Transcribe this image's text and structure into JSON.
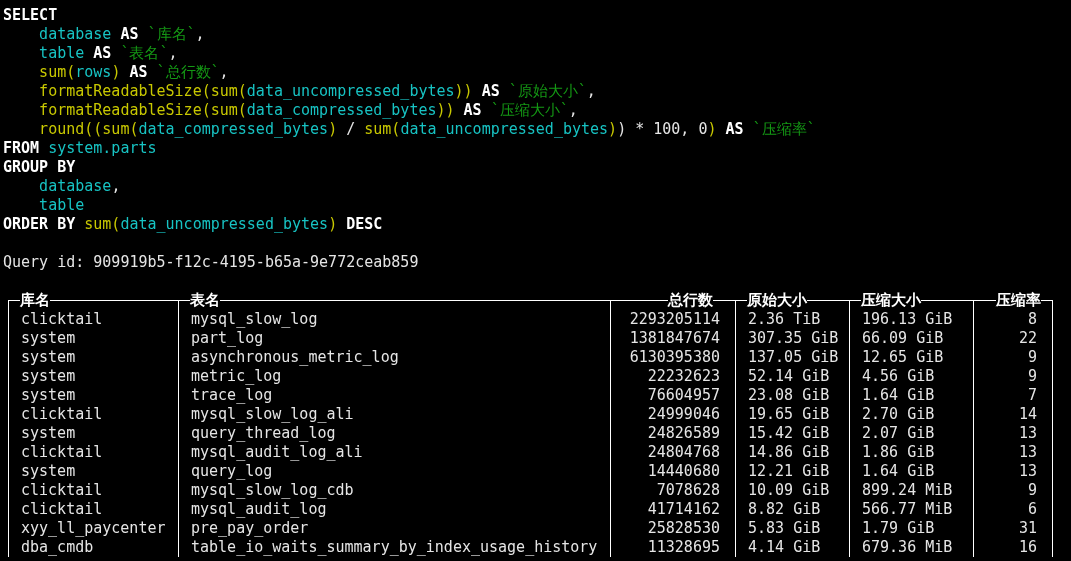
{
  "query": {
    "lines": [
      {
        "tokens": [
          {
            "kind": "keyword",
            "text": "SELECT"
          }
        ]
      },
      {
        "tokens": [
          {
            "kind": "ident",
            "text": "    database "
          },
          {
            "kind": "keyword",
            "text": "AS "
          },
          {
            "kind": "str",
            "text": "`库名`"
          },
          {
            "kind": "plain",
            "text": ","
          }
        ]
      },
      {
        "tokens": [
          {
            "kind": "ident",
            "text": "    table "
          },
          {
            "kind": "keyword",
            "text": "AS "
          },
          {
            "kind": "str",
            "text": "`表名`"
          },
          {
            "kind": "plain",
            "text": ","
          }
        ]
      },
      {
        "tokens": [
          {
            "kind": "func",
            "text": "    sum("
          },
          {
            "kind": "ident",
            "text": "rows"
          },
          {
            "kind": "func",
            "text": ") "
          },
          {
            "kind": "keyword",
            "text": "AS "
          },
          {
            "kind": "str",
            "text": "`总行数`"
          },
          {
            "kind": "plain",
            "text": ","
          }
        ]
      },
      {
        "tokens": [
          {
            "kind": "func",
            "text": "    formatReadableSize(sum("
          },
          {
            "kind": "ident",
            "text": "data_uncompressed_bytes"
          },
          {
            "kind": "func",
            "text": ")) "
          },
          {
            "kind": "keyword",
            "text": "AS "
          },
          {
            "kind": "str",
            "text": "`原始大小`"
          },
          {
            "kind": "plain",
            "text": ","
          }
        ]
      },
      {
        "tokens": [
          {
            "kind": "func",
            "text": "    formatReadableSize(sum("
          },
          {
            "kind": "ident",
            "text": "data_compressed_bytes"
          },
          {
            "kind": "func",
            "text": ")) "
          },
          {
            "kind": "keyword",
            "text": "AS "
          },
          {
            "kind": "str",
            "text": "`压缩大小`"
          },
          {
            "kind": "plain",
            "text": ","
          }
        ]
      },
      {
        "tokens": [
          {
            "kind": "func",
            "text": "    round((sum("
          },
          {
            "kind": "ident",
            "text": "data_compressed_bytes"
          },
          {
            "kind": "func",
            "text": ") "
          },
          {
            "kind": "plain",
            "text": "/ "
          },
          {
            "kind": "func",
            "text": "sum("
          },
          {
            "kind": "ident",
            "text": "data_uncompressed_bytes"
          },
          {
            "kind": "func",
            "text": ")"
          },
          {
            "kind": "plain",
            "text": ") * 100, 0"
          },
          {
            "kind": "func",
            "text": ") "
          },
          {
            "kind": "keyword",
            "text": "AS "
          },
          {
            "kind": "str",
            "text": "`压缩率`"
          }
        ]
      },
      {
        "tokens": [
          {
            "kind": "keyword",
            "text": "FROM "
          },
          {
            "kind": "ident",
            "text": "system.parts"
          }
        ]
      },
      {
        "tokens": [
          {
            "kind": "keyword",
            "text": "GROUP BY"
          }
        ]
      },
      {
        "tokens": [
          {
            "kind": "ident",
            "text": "    database"
          },
          {
            "kind": "plain",
            "text": ","
          }
        ]
      },
      {
        "tokens": [
          {
            "kind": "ident",
            "text": "    table"
          }
        ]
      },
      {
        "tokens": [
          {
            "kind": "keyword",
            "text": "ORDER BY "
          },
          {
            "kind": "func",
            "text": "sum("
          },
          {
            "kind": "ident",
            "text": "data_uncompressed_bytes"
          },
          {
            "kind": "func",
            "text": ") "
          },
          {
            "kind": "keyword",
            "text": "DESC"
          }
        ]
      }
    ]
  },
  "query_id": "Query id: 909919b5-f12c-4195-b65a-9e772ceab859",
  "table": {
    "columns": [
      "库名",
      "表名",
      "总行数",
      "原始大小",
      "压缩大小",
      "压缩率"
    ],
    "rows": [
      [
        "clicktail",
        "mysql_slow_log",
        "2293205114",
        "2.36 TiB",
        "196.13 GiB",
        "8"
      ],
      [
        "system",
        "part_log",
        "1381847674",
        "307.35 GiB",
        "66.09 GiB",
        "22"
      ],
      [
        "system",
        "asynchronous_metric_log",
        "6130395380",
        "137.05 GiB",
        "12.65 GiB",
        "9"
      ],
      [
        "system",
        "metric_log",
        "22232623",
        "52.14 GiB",
        "4.56 GiB",
        "9"
      ],
      [
        "system",
        "trace_log",
        "76604957",
        "23.08 GiB",
        "1.64 GiB",
        "7"
      ],
      [
        "clicktail",
        "mysql_slow_log_ali",
        "24999046",
        "19.65 GiB",
        "2.70 GiB",
        "14"
      ],
      [
        "system",
        "query_thread_log",
        "24826589",
        "15.42 GiB",
        "2.07 GiB",
        "13"
      ],
      [
        "clicktail",
        "mysql_audit_log_ali",
        "24804768",
        "14.86 GiB",
        "1.86 GiB",
        "13"
      ],
      [
        "system",
        "query_log",
        "14440680",
        "12.21 GiB",
        "1.64 GiB",
        "13"
      ],
      [
        "clicktail",
        "mysql_slow_log_cdb",
        "7078628",
        "10.09 GiB",
        "899.24 MiB",
        "9"
      ],
      [
        "clicktail",
        "mysql_audit_log",
        "41714162",
        "8.82 GiB",
        "566.77 MiB",
        "6"
      ],
      [
        "xyy_ll_paycenter",
        "pre_pay_order",
        "25828530",
        "5.83 GiB",
        "1.79 GiB",
        "31"
      ],
      [
        "dba_cmdb",
        "table_io_waits_summary_by_index_usage_history",
        "11328695",
        "4.14 GiB",
        "679.36 MiB",
        "16"
      ]
    ]
  }
}
